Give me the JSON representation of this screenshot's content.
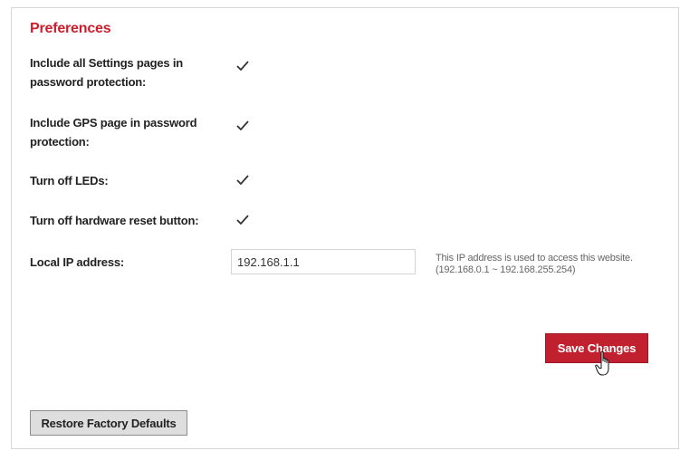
{
  "preferences": {
    "title": "Preferences",
    "options": [
      {
        "label": "Include all Settings pages in password protection:",
        "checked": true
      },
      {
        "label": "Include GPS page in password protection:",
        "checked": true
      },
      {
        "label": "Turn off LEDs:",
        "checked": true
      },
      {
        "label": "Turn off hardware reset button:",
        "checked": true
      }
    ],
    "local_ip": {
      "label": "Local IP address:",
      "value": "192.168.1.1",
      "hint": "This IP address is used to access this website.(192.168.0.1 ~ 192.168.255.254)"
    },
    "save_label": "Save Changes",
    "restore_label": "Restore Factory Defaults"
  },
  "colors": {
    "accent": "#c1202e",
    "title": "#cc1f2d",
    "restore_bg": "#dedede"
  },
  "icons": {
    "checkbox": "checkmark-icon",
    "cursor": "hand-pointer-icon"
  }
}
